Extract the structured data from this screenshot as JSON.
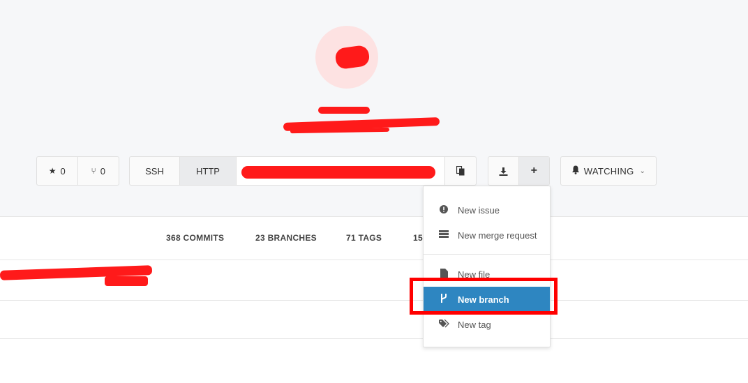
{
  "repo_header": {
    "stars_count": "0",
    "forks_count": "0"
  },
  "clone": {
    "ssh_label": "SSH",
    "http_label": "HTTP",
    "url_value": "https://"
  },
  "actions": {
    "download_icon": "download-icon",
    "plus_label": "+"
  },
  "watch": {
    "label": "WATCHING"
  },
  "stats": {
    "commits": "368 COMMITS",
    "branches": "23 BRANCHES",
    "tags": "71 TAGS",
    "partial": "15"
  },
  "dropdown": {
    "items": [
      {
        "label": "New issue",
        "icon": "exclamation-circle-icon"
      },
      {
        "label": "New merge request",
        "icon": "list-icon"
      },
      {
        "label": "New file",
        "icon": "file-icon"
      },
      {
        "label": "New branch",
        "icon": "code-fork-icon"
      },
      {
        "label": "New tag",
        "icon": "tags-icon"
      }
    ]
  },
  "colors": {
    "active_item": "#2e86c1",
    "highlight": "#ff0000"
  }
}
